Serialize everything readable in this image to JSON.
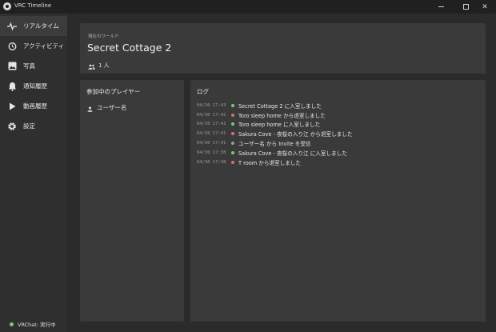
{
  "window": {
    "title": "VRC Timeline",
    "controls": {
      "minimize": "minimize-icon",
      "maximize": "maximize-icon",
      "close": "close-icon"
    }
  },
  "sidebar": {
    "items": [
      {
        "label": "リアルタイム",
        "icon": "pulse-icon",
        "active": true
      },
      {
        "label": "アクティビティ",
        "icon": "history-icon",
        "active": false
      },
      {
        "label": "写真",
        "icon": "image-icon",
        "active": false
      },
      {
        "label": "通知履歴",
        "icon": "bell-icon",
        "active": false
      },
      {
        "label": "動画履歴",
        "icon": "play-icon",
        "active": false
      },
      {
        "label": "設定",
        "icon": "gear-icon",
        "active": false
      }
    ],
    "status": {
      "text": "VRChat: 実行中",
      "color": "#6fcf7a"
    }
  },
  "world": {
    "caption": "現在のワールド",
    "name": "Secret Cottage 2",
    "count": "1 人"
  },
  "players": {
    "title": "参加中のプレイヤー",
    "items": [
      "ユーザー名"
    ]
  },
  "log": {
    "title": "ログ",
    "entries": [
      {
        "time": "04/30 17:43",
        "status": "join",
        "text": "Secret Cottage 2 に入室しました"
      },
      {
        "time": "04/30 17:42",
        "status": "leave",
        "text": "Toro sleep home から退室しました"
      },
      {
        "time": "04/30 17:41",
        "status": "join",
        "text": "Toro sleep home に入室しました"
      },
      {
        "time": "04/30 17:41",
        "status": "leave",
        "text": "Sakura Cove - 夜桜の入り江 から退室しました"
      },
      {
        "time": "04/30 17:41",
        "status": "info",
        "text": "ユーザー名 から Invite を受信"
      },
      {
        "time": "04/30 17:38",
        "status": "join",
        "text": "Sakura Cove - 夜桜の入り江 に入室しました"
      },
      {
        "time": "04/30 17:38",
        "status": "leave",
        "text": "T room から退室しました"
      }
    ],
    "colors": {
      "join": "#6fcf7a",
      "leave": "#e06c6c",
      "info": "#9a9a9a"
    }
  }
}
